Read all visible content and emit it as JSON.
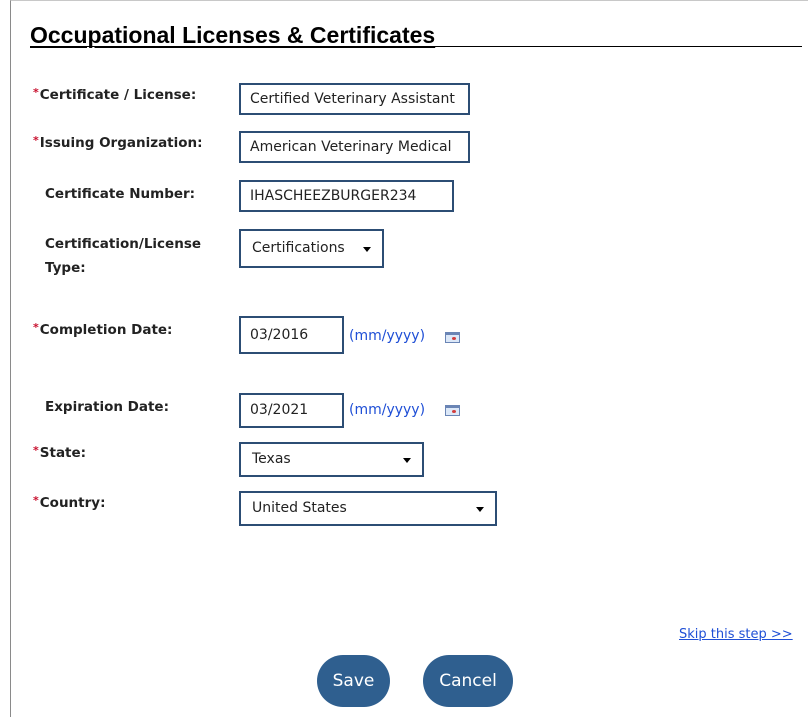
{
  "page": {
    "title": "Occupational Licenses & Certificates"
  },
  "form": {
    "required_marker": "*",
    "certificate": {
      "label": "Certificate / License:",
      "value": "Certified Veterinary Assistant",
      "required": true
    },
    "issuing_org": {
      "label": "Issuing Organization:",
      "value": "American Veterinary Medical",
      "required": true
    },
    "certificate_number": {
      "label": "Certificate Number:",
      "value": "IHASCHEEZBURGER234",
      "required": false
    },
    "cert_type": {
      "label_line1": "Certification/License",
      "label_line2": "Type:",
      "selected": "Certifications",
      "required": false
    },
    "completion_date": {
      "label": "Completion Date:",
      "value": "03/2016",
      "hint": "(mm/yyyy)",
      "required": true
    },
    "expiration_date": {
      "label": "Expiration Date:",
      "value": "03/2021",
      "hint": "(mm/yyyy)",
      "required": false
    },
    "state": {
      "label": "State:",
      "selected": "Texas",
      "required": true
    },
    "country": {
      "label": "Country:",
      "selected": "United States",
      "required": true
    }
  },
  "actions": {
    "skip_link": "Skip this step >>",
    "save": "Save",
    "cancel": "Cancel"
  },
  "icons": {
    "calendar": "calendar-icon",
    "dropdown": "chevron-down-icon"
  },
  "colors": {
    "field_border": "#2c4d74",
    "button_bg": "#2f5f8f",
    "link": "#1f4fd6",
    "required": "#c8102e"
  }
}
